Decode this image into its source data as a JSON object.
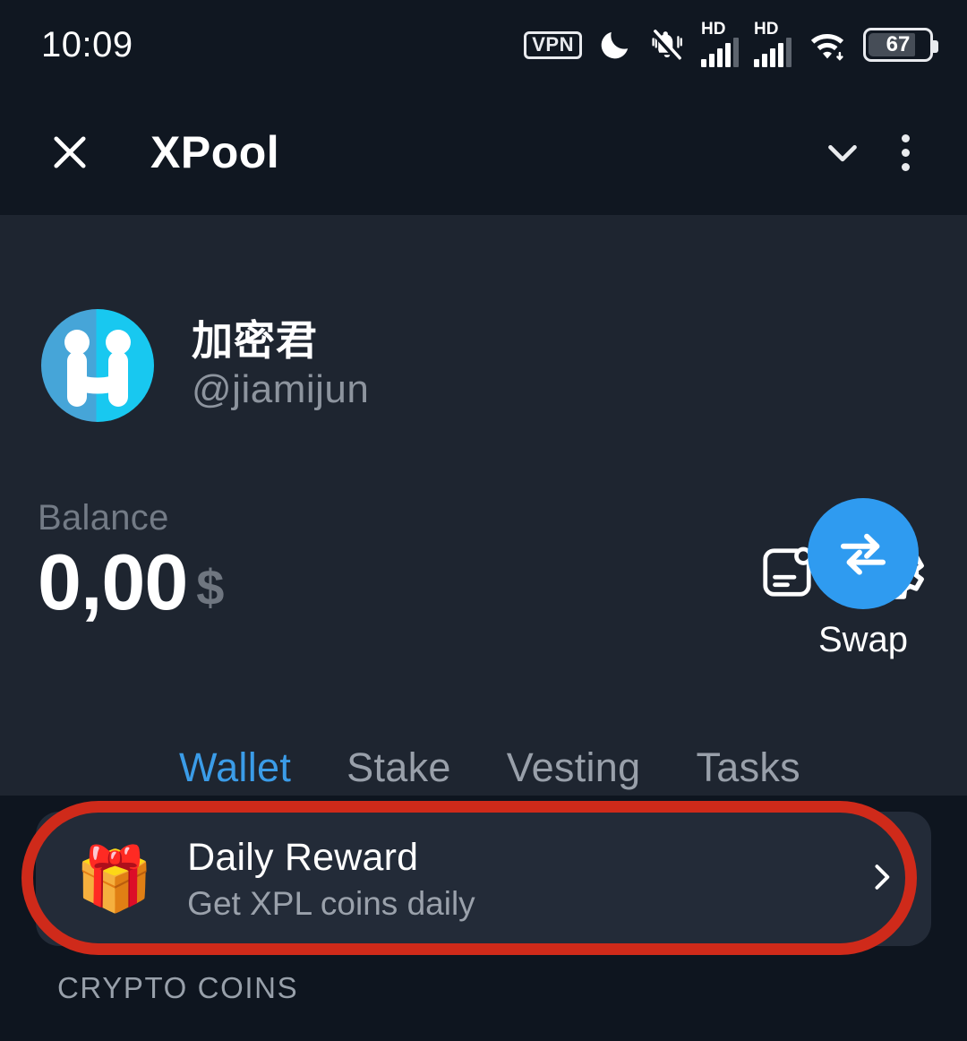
{
  "status_bar": {
    "time": "10:09",
    "battery_percent": "67",
    "icons": [
      "vpn-badge",
      "moon-dnd-icon",
      "bell-muted-icon",
      "signal-hd-icon",
      "signal-hd-icon",
      "wifi-icon",
      "battery-icon"
    ],
    "vpn_label": "VPN",
    "hd_label_1": "HD",
    "hd_label_2": "HD"
  },
  "app_bar": {
    "close_icon": "close-icon",
    "title": "XPool",
    "collapse_icon": "chevron-down-icon",
    "menu_icon": "kebab-menu-icon"
  },
  "profile": {
    "avatar": "avatar-h-logo",
    "display_name": "加密君",
    "handle": "@jiamijun",
    "actions": [
      {
        "name": "news-icon",
        "label": "News"
      },
      {
        "name": "gear-icon",
        "label": "Settings"
      }
    ]
  },
  "balance": {
    "label": "Balance",
    "value": "0,00",
    "currency": "$"
  },
  "swap": {
    "label": "Swap",
    "icon": "swap-arrows-icon"
  },
  "tabs": [
    {
      "label": "Wallet",
      "active": true
    },
    {
      "label": "Stake",
      "active": false
    },
    {
      "label": "Vesting",
      "active": false
    },
    {
      "label": "Tasks",
      "active": false
    }
  ],
  "reward_card": {
    "emoji": "🎁",
    "title": "Daily Reward",
    "subtitle": "Get XPL coins daily",
    "chevron": "chevron-right-icon",
    "highlighted": true
  },
  "section_header": "CRYPTO COINS",
  "colors": {
    "accent_blue": "#3b9ce8",
    "swap_blue": "#2f9bf0",
    "highlight_red": "#cf2a1a",
    "panel_bg": "#1e2530",
    "bar_bg": "#101721",
    "list_bg": "#0e151f",
    "card_bg": "#232b38",
    "muted_text": "#98a0aa"
  }
}
